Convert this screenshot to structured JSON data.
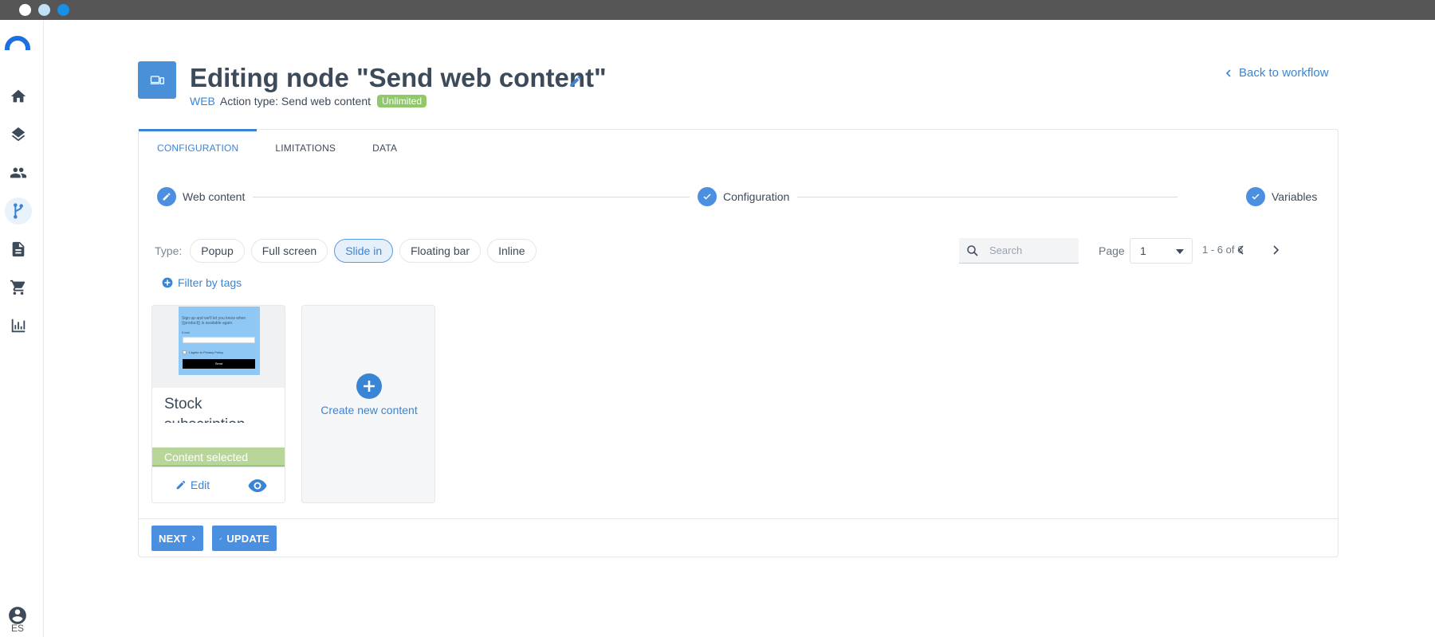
{
  "sidebar": {
    "language": "ES",
    "items": [
      {
        "icon": "home-icon"
      },
      {
        "icon": "layers-icon"
      },
      {
        "icon": "people-icon"
      },
      {
        "icon": "workflow-icon",
        "active": true
      },
      {
        "icon": "document-icon"
      },
      {
        "icon": "cart-icon"
      },
      {
        "icon": "bar-chart-icon"
      }
    ]
  },
  "header": {
    "title": "Editing node \"Send web content\"",
    "channel": "WEB",
    "action_type": "Action type: Send web content",
    "badge": "Unlimited",
    "back_link": "Back to workflow"
  },
  "tabs": [
    {
      "label": "CONFIGURATION",
      "active": true
    },
    {
      "label": "LIMITATIONS"
    },
    {
      "label": "DATA"
    }
  ],
  "steps": [
    {
      "label": "Web content",
      "icon": "pencil-icon"
    },
    {
      "label": "Configuration",
      "icon": "check-icon"
    },
    {
      "label": "Variables",
      "icon": "check-icon"
    }
  ],
  "filters": {
    "type_label": "Type:",
    "types": [
      "Popup",
      "Full screen",
      "Slide in",
      "Floating bar",
      "Inline"
    ],
    "active_type": "Slide in",
    "filter_by_tags": "Filter by tags",
    "search_placeholder": "Search",
    "page_label": "Page",
    "page_value": "1",
    "range": "1 - 6 of 6"
  },
  "content_card": {
    "title": "Stock subscription",
    "selected_label": "Content selected",
    "edit_label": "Edit",
    "thumbnail": {
      "text": "Sign up and we'll let you know when {{product}} is available again.",
      "field_label": "Email",
      "checkbox_label": "I agree to Privacy Policy",
      "button": "Send"
    }
  },
  "create_card": {
    "label": "Create new content"
  },
  "footer": {
    "next_label": "NEXT",
    "update_label": "UPDATE"
  },
  "colors": {
    "accent": "#3a84d6",
    "selected": "#b8d69a",
    "badge": "#8fc96a"
  }
}
